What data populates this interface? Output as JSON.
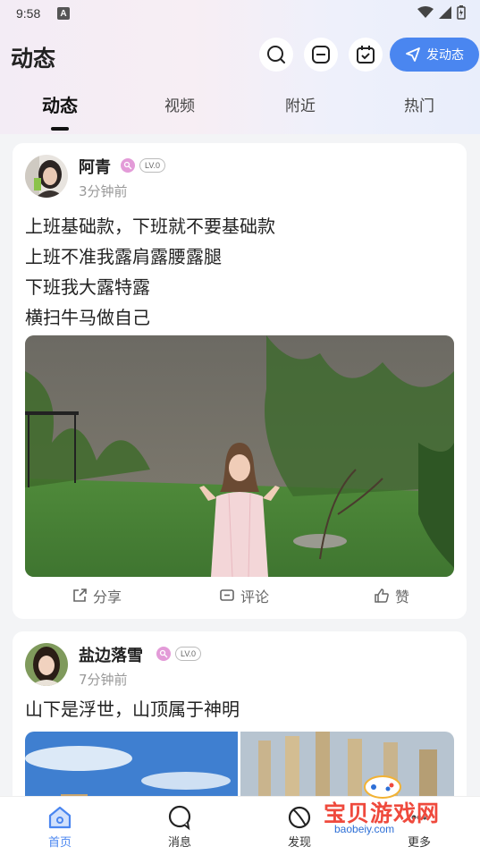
{
  "status_bar": {
    "time": "9:58",
    "notification_letter": "A"
  },
  "header": {
    "title": "动态",
    "post_button_label": "发动态"
  },
  "tabs": [
    {
      "label": "动态",
      "active": true
    },
    {
      "label": "视频",
      "active": false
    },
    {
      "label": "附近",
      "active": false
    },
    {
      "label": "热门",
      "active": false
    }
  ],
  "posts": [
    {
      "username": "阿青",
      "level": "LV.0",
      "time_ago": "3分钟前",
      "text_lines": [
        "上班基础款，下班就不要基础款",
        "上班不准我露肩露腰露腿",
        "下班我大露特露",
        "横扫牛马做自己"
      ],
      "actions": {
        "share": "分享",
        "comment": "评论",
        "like": "赞"
      }
    },
    {
      "username": "盐边落雪",
      "level": "LV.0",
      "time_ago": "7分钟前",
      "text_lines": [
        "山下是浮世，山顶属于神明"
      ]
    }
  ],
  "watermark": {
    "text": "宝贝游戏网",
    "url": "baobeiy.com"
  },
  "bottom_nav": [
    {
      "label": "首页",
      "icon": "home-icon",
      "active": true
    },
    {
      "label": "消息",
      "icon": "message-icon",
      "active": false
    },
    {
      "label": "发现",
      "icon": "discover-icon",
      "active": false
    },
    {
      "label": "更多",
      "icon": "more-icon",
      "active": false
    }
  ],
  "colors": {
    "accent": "#4a86f0",
    "vip": "#e39bd8",
    "watermark_red": "#ef4a3d"
  }
}
